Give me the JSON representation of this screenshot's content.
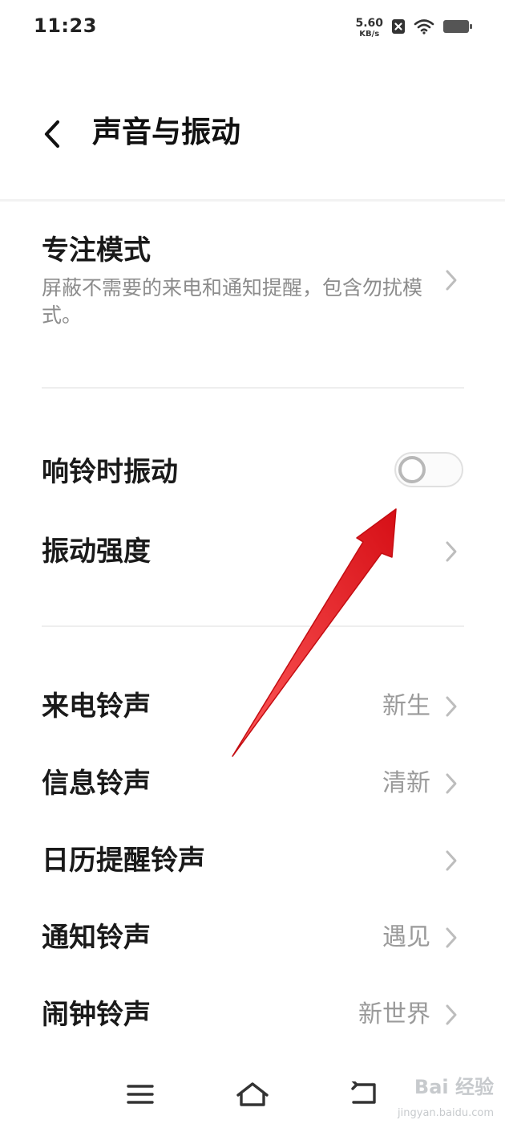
{
  "status_bar": {
    "time": "11:23",
    "net_speed_value": "5.60",
    "net_speed_unit": "KB/s",
    "icons": [
      "notification-muted-icon",
      "wifi-icon",
      "battery-icon"
    ]
  },
  "header": {
    "title": "声音与振动",
    "back_icon": "chevron-left-icon"
  },
  "focus_mode": {
    "title": "专注模式",
    "subtitle": "屏蔽不需要的来电和通知提醒，包含勿扰模式。"
  },
  "vibration": {
    "ring_vibrate_label": "响铃时振动",
    "ring_vibrate_enabled": false,
    "intensity_label": "振动强度"
  },
  "ringtones": [
    {
      "label": "来电铃声",
      "value": "新生"
    },
    {
      "label": "信息铃声",
      "value": "清新"
    },
    {
      "label": "日历提醒铃声",
      "value": ""
    },
    {
      "label": "通知铃声",
      "value": "遇见"
    },
    {
      "label": "闹钟铃声",
      "value": "新世界"
    }
  ],
  "nav_bar": {
    "icons": [
      "menu-icon",
      "home-icon",
      "back-icon"
    ]
  },
  "watermark": {
    "logo": "Bai 经验",
    "url": "jingyan.baidu.com"
  },
  "colors": {
    "annotation_arrow": "#e8141b",
    "secondary_text": "#8c8c8c",
    "divider": "#eeeeee"
  }
}
